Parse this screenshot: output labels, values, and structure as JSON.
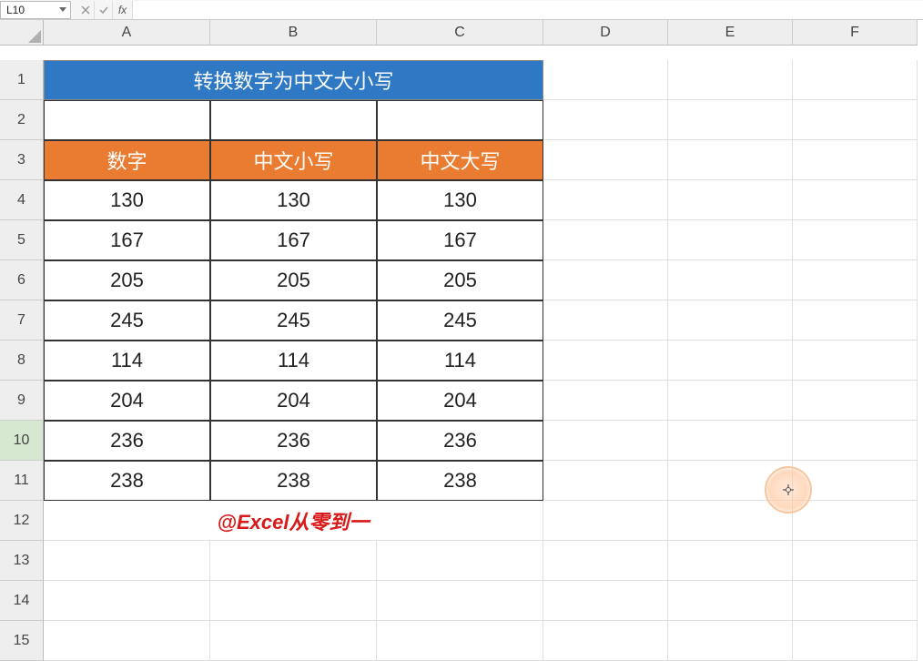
{
  "name_box": "L10",
  "fx_label": "fx",
  "formula_value": "",
  "columns": [
    "A",
    "B",
    "C",
    "D",
    "E",
    "F"
  ],
  "row_count": 15,
  "selected_row": 10,
  "title": "转换数字为中文大小写",
  "table": {
    "headers": [
      "数字",
      "中文小写",
      "中文大写"
    ],
    "rows": [
      [
        "130",
        "130",
        "130"
      ],
      [
        "167",
        "167",
        "167"
      ],
      [
        "205",
        "205",
        "205"
      ],
      [
        "245",
        "245",
        "245"
      ],
      [
        "114",
        "114",
        "114"
      ],
      [
        "204",
        "204",
        "204"
      ],
      [
        "236",
        "236",
        "236"
      ],
      [
        "238",
        "238",
        "238"
      ]
    ]
  },
  "watermark": "@Excel从零到一",
  "colors": {
    "title_bg": "#2f79c4",
    "header_bg": "#e97c30",
    "watermark": "#d91a1a"
  }
}
